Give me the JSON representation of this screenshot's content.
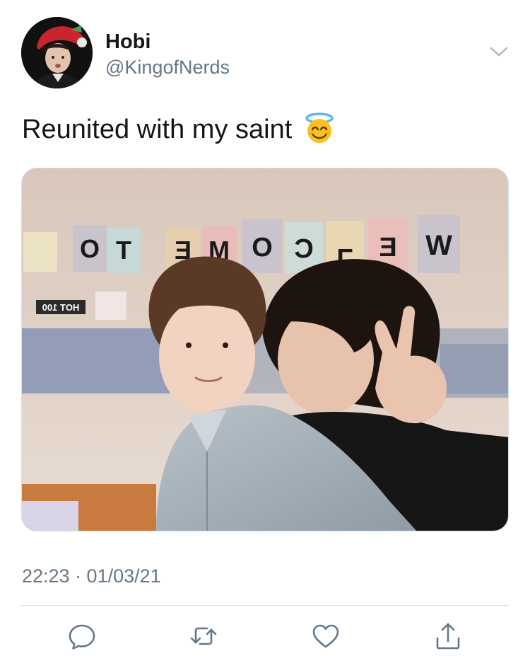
{
  "user": {
    "display_name": "Hobi",
    "handle": "@KingofNerds",
    "avatar_icon": "avatar-photo"
  },
  "tweet": {
    "text": "Reunited with my saint",
    "emoji": "smiling-face-with-halo",
    "timestamp": "22:23 · 01/03/21"
  },
  "media": {
    "banner_letters": [
      "O",
      "T",
      "E",
      "M",
      "O",
      "C",
      "L",
      "E",
      "W"
    ],
    "sign_text": "HOT 100"
  },
  "actions": [
    {
      "name": "reply",
      "icon": "reply-icon"
    },
    {
      "name": "retweet",
      "icon": "retweet-icon"
    },
    {
      "name": "like",
      "icon": "heart-icon"
    },
    {
      "name": "share",
      "icon": "share-icon"
    }
  ],
  "colors": {
    "text_primary": "#14171a",
    "text_secondary": "#657786",
    "divider": "#d6dde3",
    "icon": "#657786"
  }
}
